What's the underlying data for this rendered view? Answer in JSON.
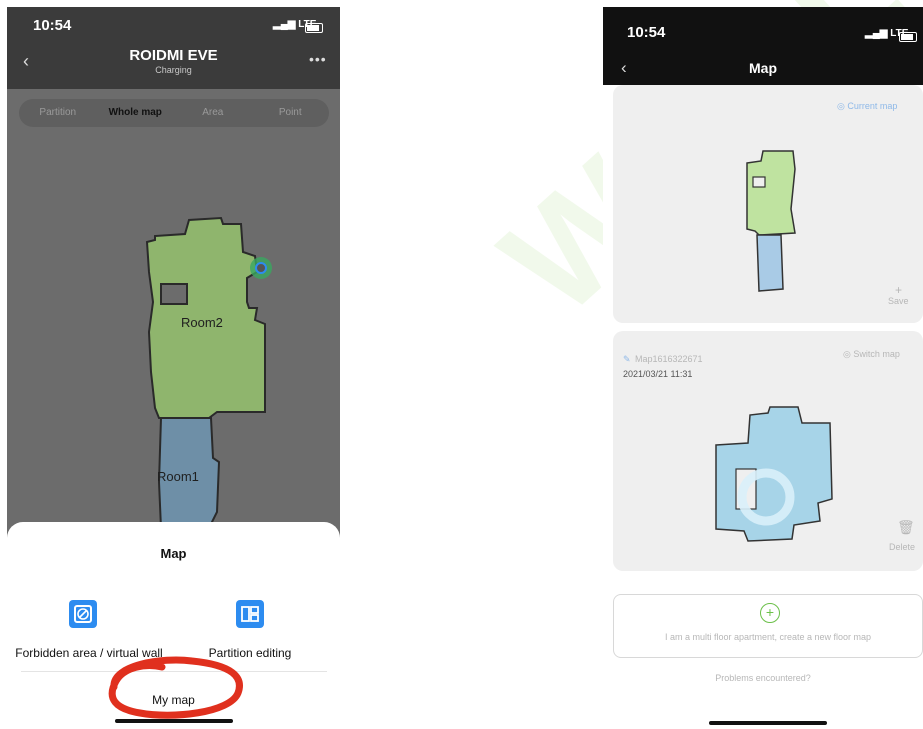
{
  "phone_left": {
    "status": {
      "time": "10:54",
      "signal": "LTE"
    },
    "header": {
      "title": "ROIDMI EVE",
      "subtitle": "Charging",
      "back_icon": "chevron-left-icon",
      "more_icon": "more-icon"
    },
    "mode_tabs": [
      "Partition",
      "Whole map",
      "Area",
      "Point"
    ],
    "active_tab": "Whole map",
    "rooms": [
      {
        "label": "Room2",
        "color": "#8fb56d"
      },
      {
        "label": "Room1",
        "color": "#6e8fa7"
      }
    ],
    "sheet": {
      "title": "Map",
      "options": [
        {
          "label": "Forbidden area / virtual wall",
          "icon": "forbidden-icon"
        },
        {
          "label": "Partition editing",
          "icon": "partition-icon"
        }
      ],
      "my_map": "My map"
    }
  },
  "phone_right": {
    "status": {
      "time": "10:54",
      "signal": "LTE"
    },
    "header": {
      "title": "Map",
      "back_icon": "chevron-left-icon"
    },
    "current_card": {
      "badge": "Current map",
      "save_label": "Save",
      "room_colors": [
        "#bfe3a0",
        "#a9cbe6"
      ]
    },
    "saved_card": {
      "name": "Map1616322671",
      "switch_label": "Switch map",
      "date": "2021/03/21 11:31",
      "delete_label": "Delete",
      "map_color": "#a7d4e8"
    },
    "new_floor": "I am a multi floor apartment, create a new floor map",
    "problems": "Problems encountered?"
  },
  "colors": {
    "accent_blue": "#2d8cf0",
    "annotation_red": "#e0301e"
  }
}
